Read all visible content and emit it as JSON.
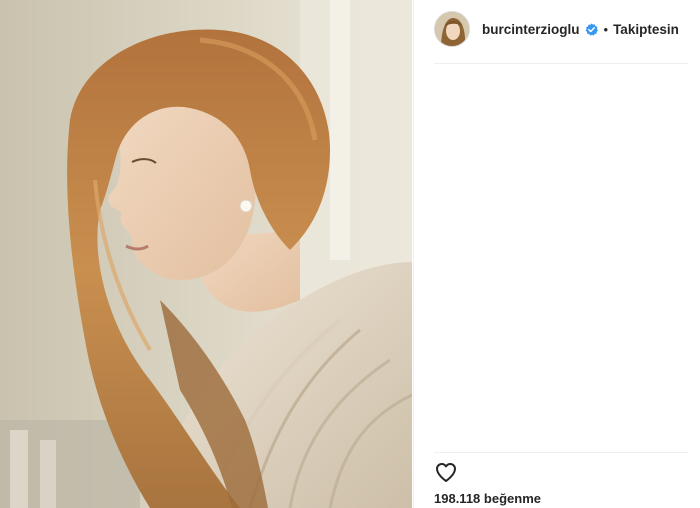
{
  "post": {
    "photo": {
      "description_icon": "portrait-photo"
    },
    "author": {
      "username": "burcinterzioglu",
      "verified_icon": "verified-badge-icon",
      "separator": "•",
      "follow_state": "Takiptesin"
    },
    "actions": {
      "like_icon": "heart-outline-icon",
      "likes_count": "198.118",
      "likes_word": "beğenme"
    },
    "colors": {
      "verified_blue": "#3897f0",
      "text": "#262626",
      "divider": "#efefef"
    }
  }
}
